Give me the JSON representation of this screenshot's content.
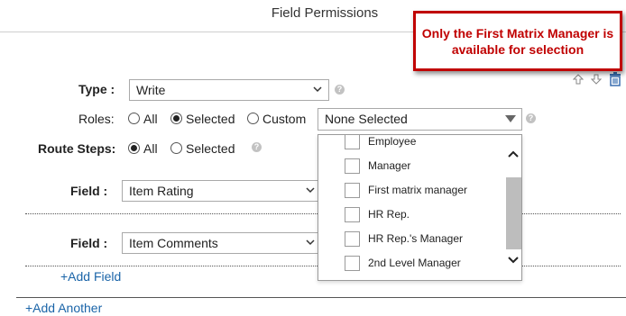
{
  "header": {
    "title": "Field Permissions"
  },
  "callout": {
    "text": "Only the First Matrix Manager is available for selection"
  },
  "type_row": {
    "label": "Type :",
    "value": "Write"
  },
  "roles_row": {
    "label": "Roles:",
    "options": [
      "All",
      "Selected",
      "Custom"
    ],
    "selected": "Selected",
    "dropdown_value": "None Selected"
  },
  "route_row": {
    "label": "Route Steps:",
    "options": [
      "All",
      "Selected"
    ],
    "selected": "All"
  },
  "fields": [
    {
      "label": "Field :",
      "value": "Item Rating"
    },
    {
      "label": "Field :",
      "value": "Item Comments"
    }
  ],
  "dropdown_options": [
    {
      "label": "Employee",
      "checked": false
    },
    {
      "label": "Manager",
      "checked": false
    },
    {
      "label": "First matrix manager",
      "checked": false
    },
    {
      "label": "HR Rep.",
      "checked": false
    },
    {
      "label": "HR Rep.'s Manager",
      "checked": false
    },
    {
      "label": "2nd Level Manager",
      "checked": false
    }
  ],
  "links": {
    "add_field": "+Add Field",
    "add_another": "+Add Another"
  },
  "icons": [
    "arrow-up-icon",
    "arrow-down-icon",
    "trash-icon",
    "help-icon",
    "chevron-down-icon",
    "chevron-up-icon"
  ]
}
